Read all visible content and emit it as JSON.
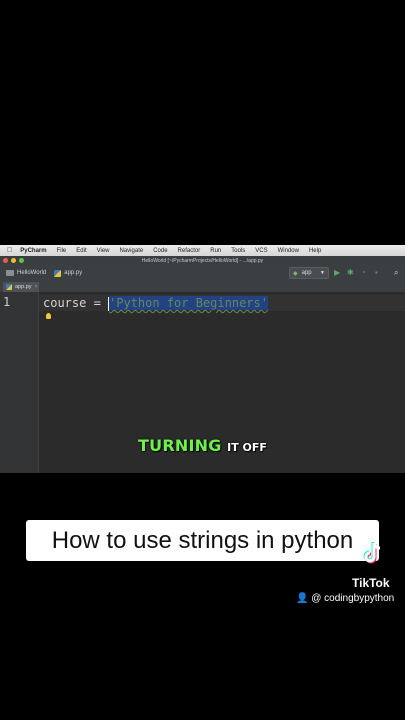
{
  "menubar": {
    "items": [
      "PyCharm",
      "File",
      "Edit",
      "View",
      "Navigate",
      "Code",
      "Refactor",
      "Run",
      "Tools",
      "VCS",
      "Window",
      "Help"
    ]
  },
  "window": {
    "title": "HelloWorld [~/PycharmProjects/HelloWorld] - .../app.py"
  },
  "navbar": {
    "project": "HelloWorld",
    "file": "app.py",
    "run_config": "app"
  },
  "tab": {
    "label": "app.py",
    "close": "×"
  },
  "editor": {
    "line_number": "1",
    "code_before": "course = ",
    "string_literal": "'Python for Beginners'"
  },
  "caption": {
    "highlight": "TURNING",
    "rest": "IT OFF"
  },
  "video_title": "How to use strings in python",
  "tiktok": {
    "brand": "TikTok",
    "username": "@ codingbypython"
  },
  "colors": {
    "string": "#6a8759",
    "caption_green": "#6cf24a",
    "editor_bg": "#2b2b2b"
  }
}
